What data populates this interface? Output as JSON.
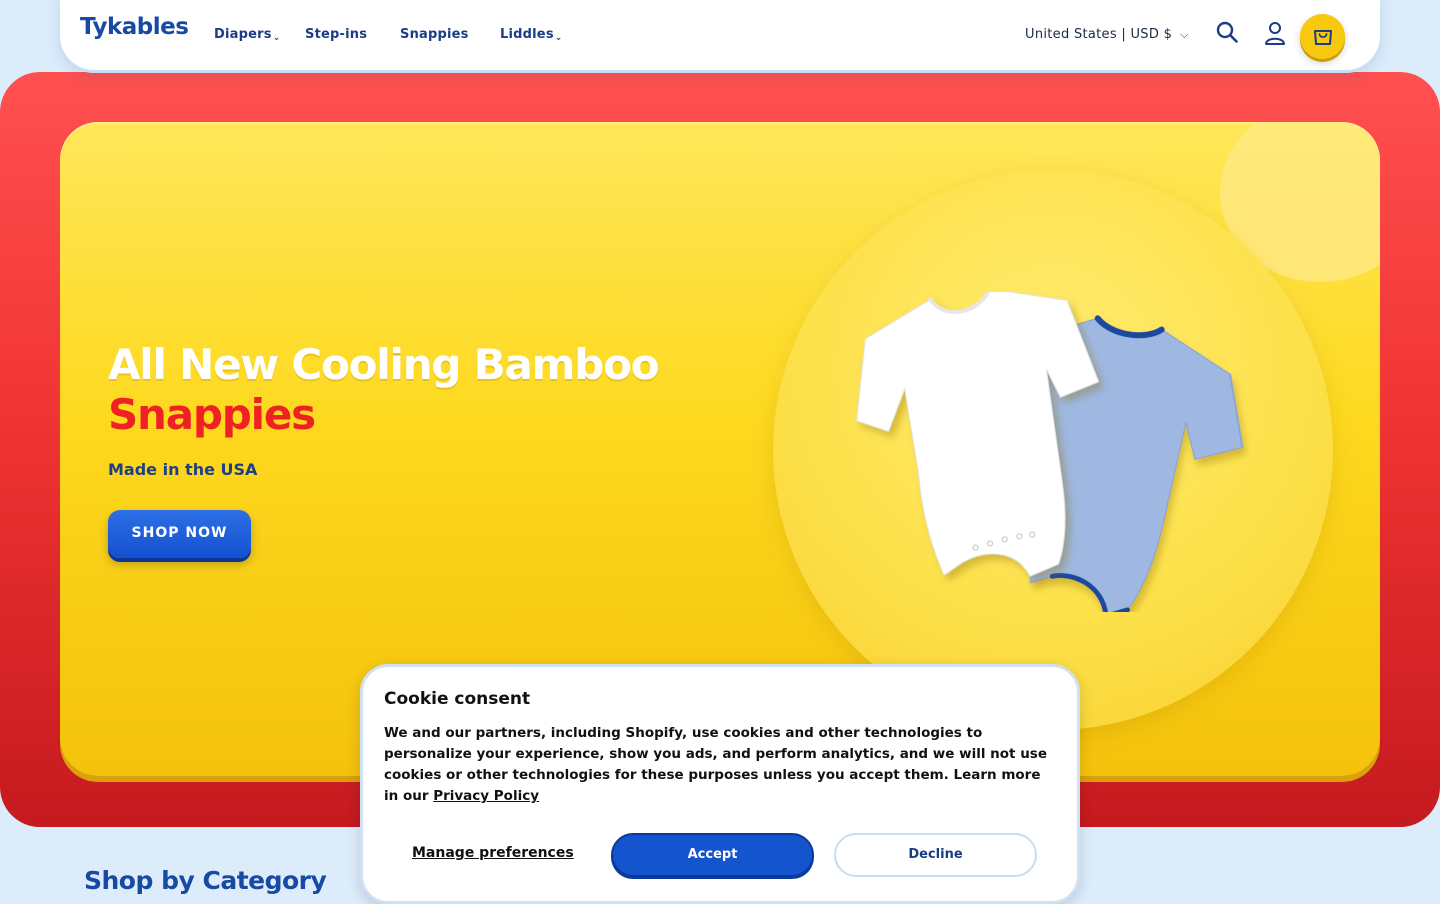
{
  "header": {
    "logo": "Tykables",
    "nav": [
      {
        "label": "Diapers",
        "has_dropdown": true
      },
      {
        "label": "Step-ins",
        "has_dropdown": false
      },
      {
        "label": "Snappies",
        "has_dropdown": false
      },
      {
        "label": "Liddles",
        "has_dropdown": true
      }
    ],
    "region_label": "United States | USD $",
    "icons": [
      "search-icon",
      "account-icon",
      "cart-icon"
    ]
  },
  "hero": {
    "title_line1": "All New Cooling Bamboo",
    "title_line2": "Snappies",
    "subtitle": "Made in the USA",
    "cta_label": "SHOP NOW",
    "image": "two-baby-onesies-white-and-light-blue"
  },
  "section": {
    "title": "Shop by Category"
  },
  "cookie": {
    "title": "Cookie consent",
    "body": "We and our partners, including Shopify, use cookies and other technologies to personalize your experience, show you ads, and perform analytics, and we will not use cookies or other technologies for these purposes unless you accept them. Learn more in our",
    "privacy_link": "Privacy Policy",
    "manage_label": "Manage preferences",
    "accept_label": "Accept",
    "decline_label": "Decline"
  },
  "colors": {
    "brand_blue": "#1849a3",
    "accent_yellow": "#fdd91f",
    "hero_red": "#f13434",
    "button_blue": "#1454cf"
  }
}
